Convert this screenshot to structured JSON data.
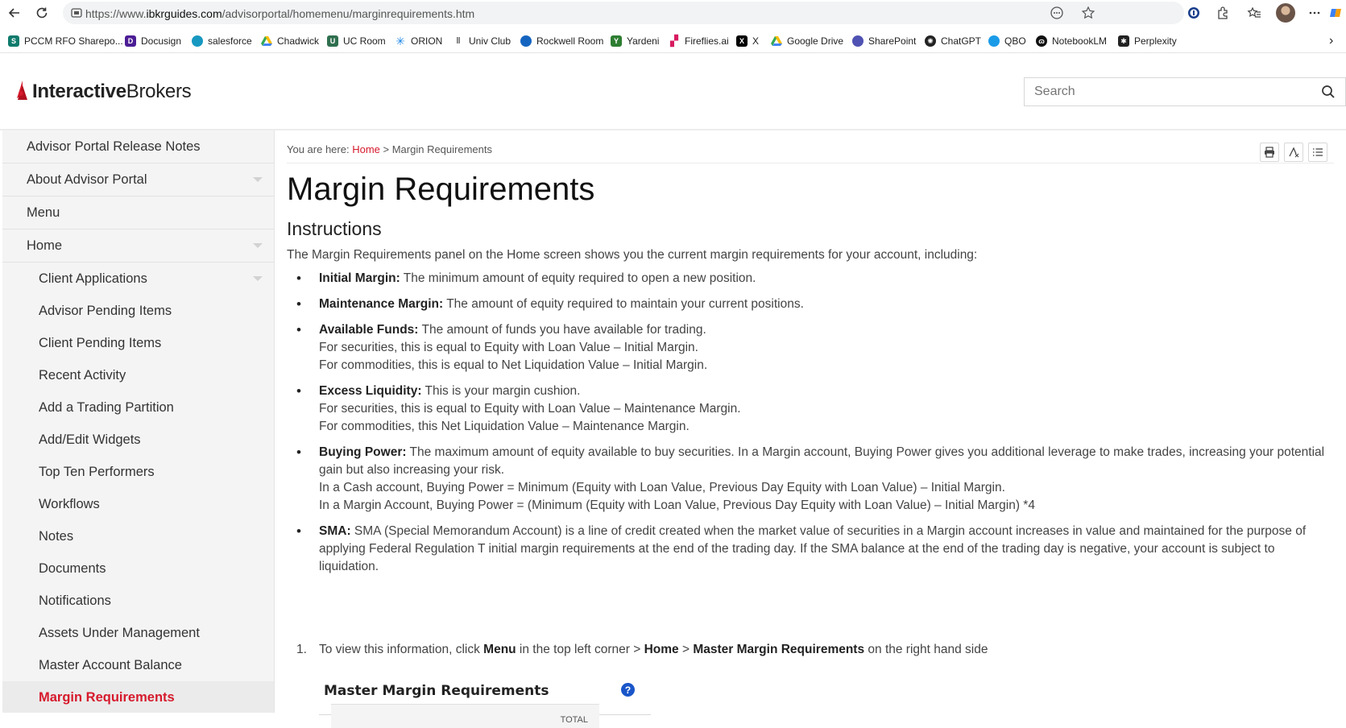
{
  "browser": {
    "url_prefix": "https://www.",
    "url_domain": "ibkrguides.com",
    "url_path": "/advisorportal/homemenu/marginrequirements.htm",
    "bookmarks": [
      {
        "label": "PCCM RFO Sharepo...",
        "icon": "sharepoint-icon",
        "color": "#0f7b6c"
      },
      {
        "label": "Docusign",
        "icon": "docusign-icon",
        "color": "#4c1d95"
      },
      {
        "label": "salesforce",
        "icon": "salesforce-icon",
        "color": "#1798c1"
      },
      {
        "label": "Chadwick",
        "icon": "drive-icon",
        "color": "#34a853"
      },
      {
        "label": "UC Room",
        "icon": "uc-room-icon",
        "color": "#2f6f4f"
      },
      {
        "label": "ORION",
        "icon": "orion-icon",
        "color": "#1e88e5"
      },
      {
        "label": "Univ Club",
        "icon": "univ-club-icon",
        "color": "#555555"
      },
      {
        "label": "Rockwell Room",
        "icon": "rockwell-icon",
        "color": "#1565c0"
      },
      {
        "label": "Yardeni",
        "icon": "yardeni-icon",
        "color": "#2e7d32"
      },
      {
        "label": "Fireflies.ai",
        "icon": "fireflies-icon",
        "color": "#d81b60"
      },
      {
        "label": "X",
        "icon": "x-icon",
        "color": "#000000"
      },
      {
        "label": "Google Drive",
        "icon": "google-drive-icon",
        "color": "#fbbc04"
      },
      {
        "label": "SharePoint",
        "icon": "sharepoint-icon",
        "color": "#4f52b2"
      },
      {
        "label": "ChatGPT",
        "icon": "chatgpt-icon",
        "color": "#222222"
      },
      {
        "label": "QBO",
        "icon": "qbo-icon",
        "color": "#2ca01c"
      },
      {
        "label": "NotebookLM",
        "icon": "notebooklm-icon",
        "color": "#111111"
      },
      {
        "label": "Perplexity",
        "icon": "perplexity-icon",
        "color": "#222222"
      }
    ]
  },
  "header": {
    "logo_bold": "Interactive",
    "logo_regular": "Brokers",
    "brand_color": "#d61a2c",
    "search_placeholder": "Search"
  },
  "sidebar": {
    "items": [
      {
        "label": "Advisor Portal Release Notes",
        "level": 1,
        "caret": false
      },
      {
        "label": "About Advisor Portal",
        "level": 1,
        "caret": true
      },
      {
        "label": "Menu",
        "level": 1,
        "caret": false
      },
      {
        "label": "Home",
        "level": 1,
        "caret": true
      }
    ],
    "sub_items": [
      {
        "label": "Client Applications",
        "caret": true
      },
      {
        "label": "Advisor Pending Items",
        "caret": false
      },
      {
        "label": "Client Pending Items",
        "caret": false
      },
      {
        "label": "Recent Activity",
        "caret": false
      },
      {
        "label": "Add a Trading Partition",
        "caret": false
      },
      {
        "label": "Add/Edit Widgets",
        "caret": false
      },
      {
        "label": "Top Ten Performers",
        "caret": false
      },
      {
        "label": "Workflows",
        "caret": false
      },
      {
        "label": "Notes",
        "caret": false
      },
      {
        "label": "Documents",
        "caret": false
      },
      {
        "label": "Notifications",
        "caret": false
      },
      {
        "label": "Assets Under Management",
        "caret": false
      },
      {
        "label": "Master Account Balance",
        "caret": false
      },
      {
        "label": "Margin Requirements",
        "caret": false,
        "active": true
      }
    ]
  },
  "breadcrumb": {
    "prefix": "You are here: ",
    "home": "Home",
    "separator": " > ",
    "current": "Margin Requirements"
  },
  "content": {
    "title": "Margin Requirements",
    "subtitle": "Instructions",
    "intro": "The Margin Requirements panel on the Home screen shows you the current margin requirements for your account, including:",
    "bullets": [
      {
        "term": "Initial Margin:",
        "lines": [
          "The minimum amount of equity required to open a new position."
        ]
      },
      {
        "term": "Maintenance Margin:",
        "lines": [
          "The amount of equity required to maintain your current positions."
        ]
      },
      {
        "term": "Available Funds:",
        "lines": [
          "The amount of funds you have available for trading.",
          "For securities, this is equal to Equity with Loan Value – Initial Margin.",
          "For commodities, this is equal to Net Liquidation Value – Initial Margin."
        ]
      },
      {
        "term": "Excess Liquidity:",
        "lines": [
          "This is your margin cushion.",
          "For securities, this is equal to Equity with Loan Value – Maintenance Margin.",
          "For commodities, this Net Liquidation Value – Maintenance Margin."
        ]
      },
      {
        "term": "Buying Power:",
        "lines": [
          "The maximum amount of equity available to buy securities. In a Margin account, Buying Power gives you additional leverage to make trades, increasing your potential gain but also increasing your risk.",
          "In a Cash account, Buying Power = Minimum (Equity with Loan Value, Previous Day Equity with Loan Value) – Initial Margin.",
          "In a Margin Account, Buying Power = (Minimum (Equity with Loan Value, Previous Day Equity with Loan Value) – Initial Margin) *4"
        ]
      },
      {
        "term": "SMA:",
        "lines": [
          "SMA (Special Memorandum Account) is a line of credit created when the market value of securities in a Margin account increases in value and maintained for the purpose of applying Federal Regulation T initial margin requirements at the end of the trading day. If the SMA balance at the end of the trading day is negative, your account is subject to liquidation."
        ]
      }
    ],
    "step": {
      "number": "1.",
      "text_1": "To view this information, click ",
      "bold_1": "Menu",
      "text_2": " in the top left corner > ",
      "bold_2": "Home",
      "text_3": " > ",
      "bold_3": "Master Margin Requirements",
      "text_4": " on the right hand side"
    },
    "widget": {
      "title": "Master Margin Requirements",
      "help": "?",
      "column_header": "TOTAL"
    }
  }
}
